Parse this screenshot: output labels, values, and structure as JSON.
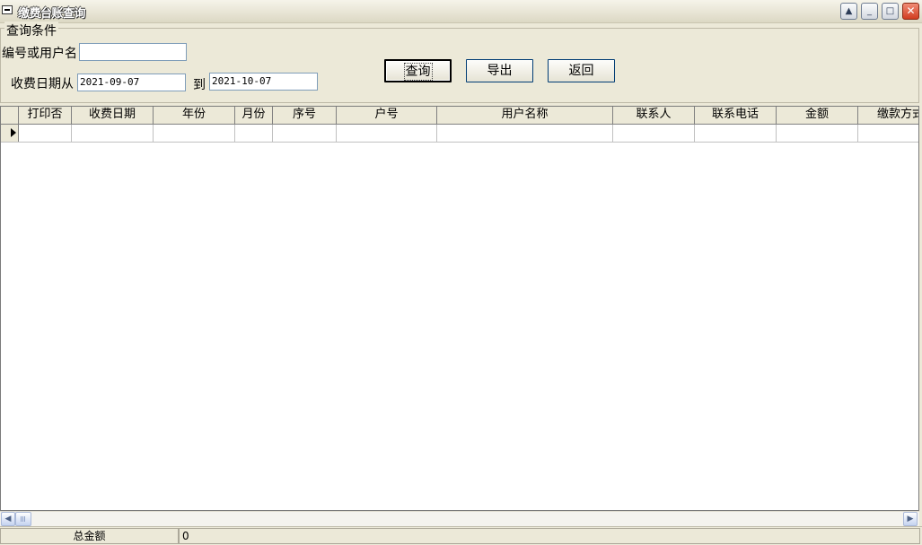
{
  "window": {
    "title": "缴费台账查询",
    "controls": {
      "up": "▲",
      "minimize": "_",
      "maximize": "□",
      "close": "✕"
    }
  },
  "query": {
    "group_title": "查询条件",
    "id_label": "编号或用户名",
    "id_value": "",
    "date_label": "收费日期从",
    "date_from": "2021-09-07",
    "to_label": "到",
    "date_to": "2021-10-07",
    "buttons": {
      "search": "查询",
      "export": "导出",
      "back": "返回"
    }
  },
  "grid": {
    "columns": [
      "打印否",
      "收费日期",
      "年份",
      "月份",
      "序号",
      "户号",
      "用户名称",
      "联系人",
      "联系电话",
      "金额",
      "缴款方式"
    ]
  },
  "scrollbar": {
    "left": "◀",
    "right": "▶"
  },
  "status": {
    "total_label": "总金额",
    "total_value": "0"
  }
}
